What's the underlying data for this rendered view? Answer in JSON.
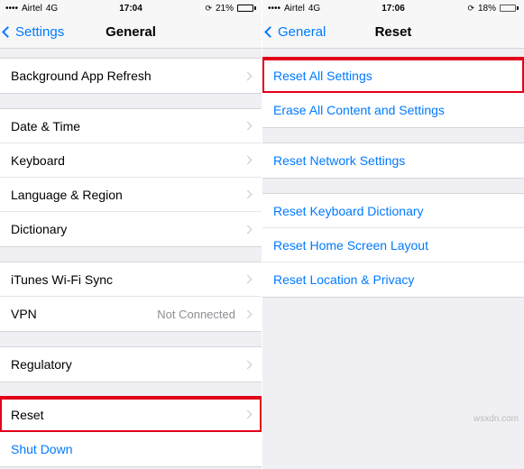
{
  "left": {
    "status": {
      "carrier": "Airtel",
      "network": "4G",
      "time": "17:04",
      "battery_pct": "21%",
      "battery_fill": 21
    },
    "nav": {
      "back": "Settings",
      "title": "General"
    },
    "groups": [
      [
        {
          "label": "Background App Refresh",
          "chevron": true
        }
      ],
      [
        {
          "label": "Date & Time",
          "chevron": true
        },
        {
          "label": "Keyboard",
          "chevron": true
        },
        {
          "label": "Language & Region",
          "chevron": true
        },
        {
          "label": "Dictionary",
          "chevron": true
        }
      ],
      [
        {
          "label": "iTunes Wi-Fi Sync",
          "chevron": true
        },
        {
          "label": "VPN",
          "detail": "Not Connected",
          "chevron": true
        }
      ],
      [
        {
          "label": "Regulatory",
          "chevron": true
        }
      ],
      [
        {
          "label": "Reset",
          "chevron": true,
          "highlight": true
        },
        {
          "label": "Shut Down",
          "link": true
        }
      ]
    ]
  },
  "right": {
    "status": {
      "carrier": "Airtel",
      "network": "4G",
      "time": "17:06",
      "battery_pct": "18%",
      "battery_fill": 18,
      "low": true
    },
    "nav": {
      "back": "General",
      "title": "Reset"
    },
    "groups": [
      [
        {
          "label": "Reset All Settings",
          "link": true,
          "highlight": true
        },
        {
          "label": "Erase All Content and Settings",
          "link": true
        }
      ],
      [
        {
          "label": "Reset Network Settings",
          "link": true
        }
      ],
      [
        {
          "label": "Reset Keyboard Dictionary",
          "link": true
        },
        {
          "label": "Reset Home Screen Layout",
          "link": true
        },
        {
          "label": "Reset Location & Privacy",
          "link": true
        }
      ]
    ]
  },
  "watermark": "wsxdn.com"
}
